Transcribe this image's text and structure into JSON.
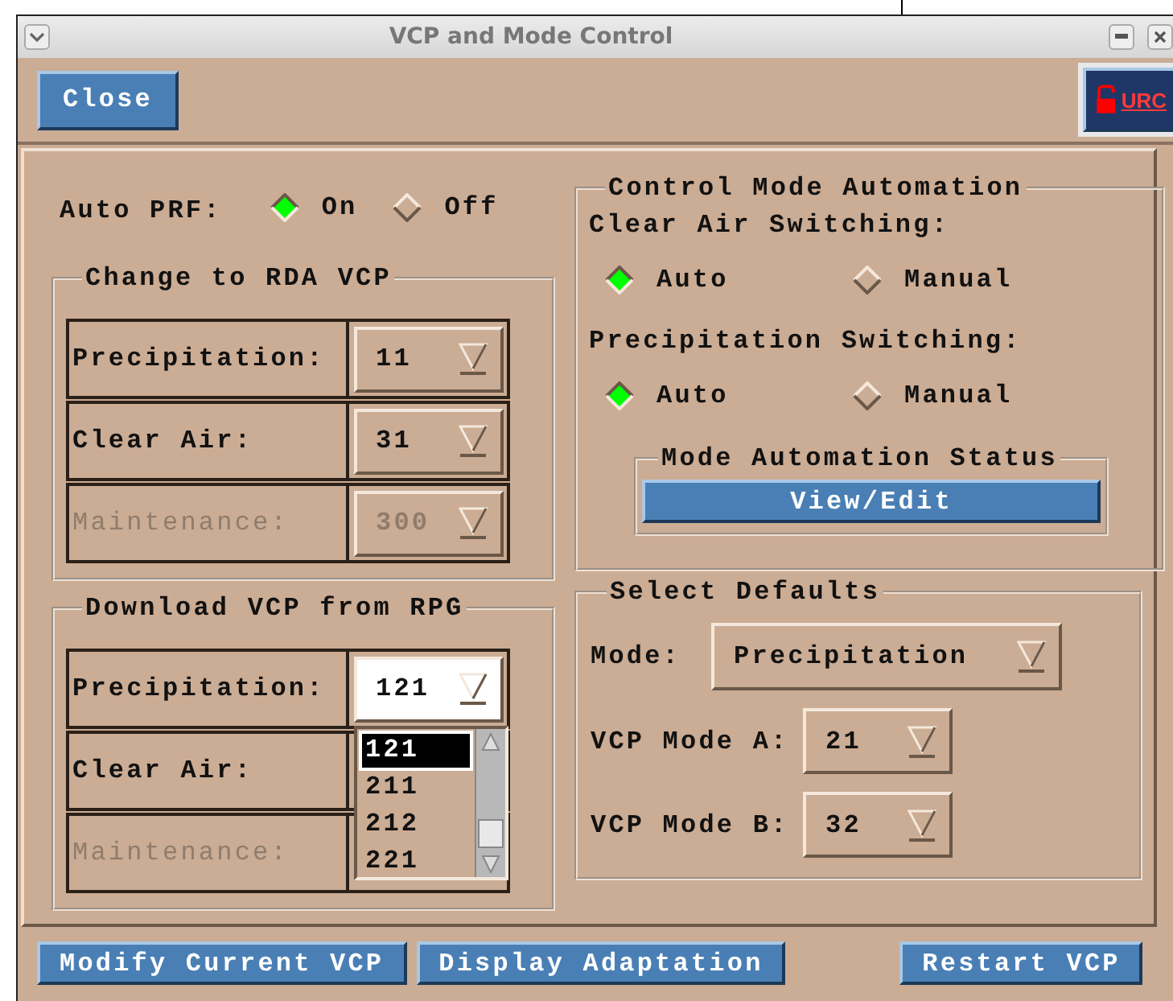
{
  "window": {
    "title": "VCP and Mode Control"
  },
  "toolbar": {
    "close_button": "Close",
    "urc_button": "URC"
  },
  "auto_prf": {
    "label": "Auto PRF:",
    "options": [
      {
        "label": "On",
        "selected": true
      },
      {
        "label": "Off",
        "selected": false
      }
    ]
  },
  "change_to_rda_vcp": {
    "title": "Change to RDA VCP",
    "rows": [
      {
        "label": "Precipitation:",
        "value": "11",
        "disabled": false,
        "open": false
      },
      {
        "label": "Clear Air:",
        "value": "31",
        "disabled": false,
        "open": false
      },
      {
        "label": "Maintenance:",
        "value": "300",
        "disabled": true,
        "open": false
      }
    ]
  },
  "download_vcp_from_rpg": {
    "title": "Download VCP from RPG",
    "rows": [
      {
        "label": "Precipitation:",
        "value": "121",
        "disabled": false,
        "open": true
      },
      {
        "label": "Clear Air:",
        "disabled": false
      },
      {
        "label": "Maintenance:",
        "disabled": true
      }
    ],
    "dropdown_list": [
      {
        "label": "121",
        "selected": true
      },
      {
        "label": "211",
        "selected": false
      },
      {
        "label": "212",
        "selected": false
      },
      {
        "label": "221",
        "selected": false
      }
    ]
  },
  "control_mode_automation": {
    "title": "Control Mode Automation",
    "switches": [
      {
        "label": "Clear Air Switching:",
        "options": [
          {
            "label": "Auto",
            "selected": true
          },
          {
            "label": "Manual",
            "selected": false
          }
        ]
      },
      {
        "label": "Precipitation Switching:",
        "options": [
          {
            "label": "Auto",
            "selected": true
          },
          {
            "label": "Manual",
            "selected": false
          }
        ]
      }
    ],
    "status": {
      "title": "Mode Automation Status",
      "button": "View/Edit"
    }
  },
  "select_defaults": {
    "title": "Select Defaults",
    "fields": [
      {
        "label": "Mode:",
        "value": "Precipitation"
      },
      {
        "label": "VCP Mode A:",
        "value": "21"
      },
      {
        "label": "VCP Mode B:",
        "value": "32"
      }
    ]
  },
  "buttons": [
    {
      "label": "Modify Current VCP"
    },
    {
      "label": "Display Adaptation"
    },
    {
      "label": "Restart VCP"
    }
  ]
}
